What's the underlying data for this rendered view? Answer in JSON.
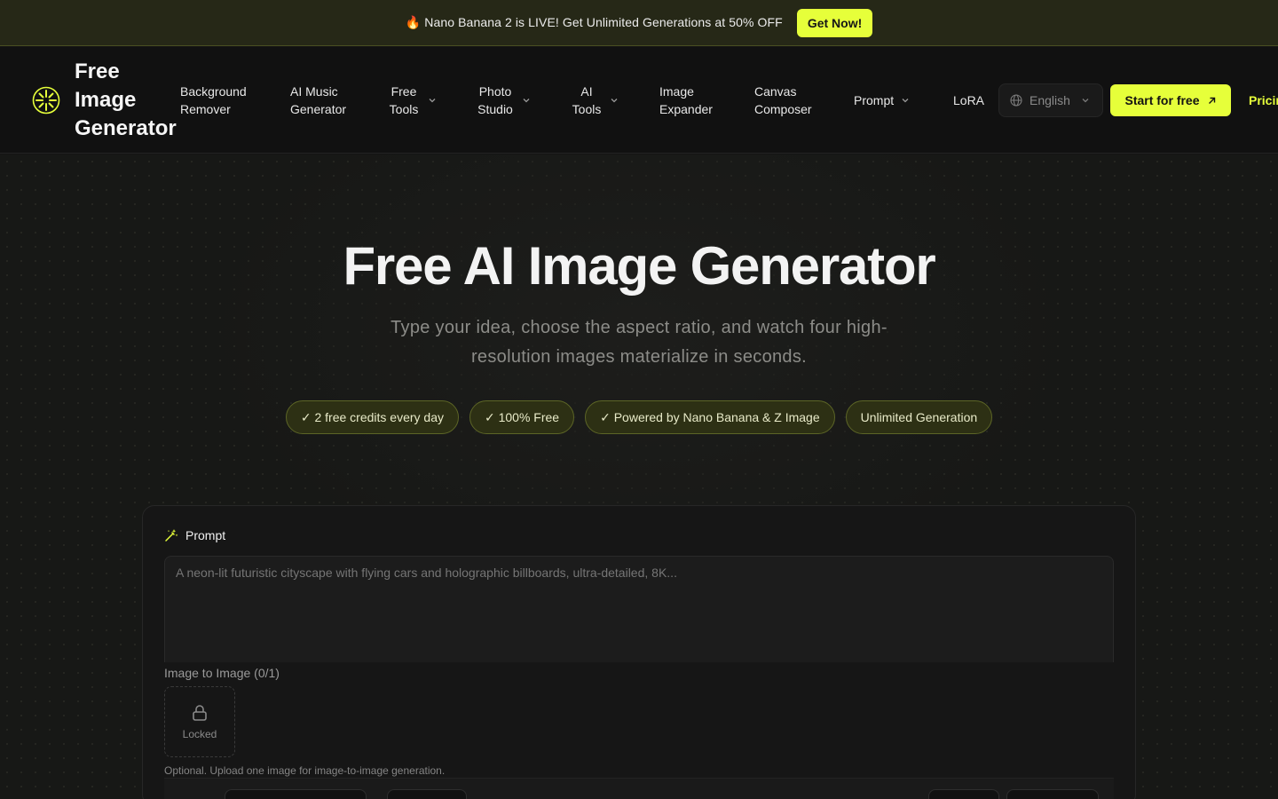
{
  "announcement": {
    "text": "🔥 Nano Banana 2 is LIVE! Get Unlimited Generations at 50% OFF",
    "button": "Get Now!"
  },
  "header": {
    "logo_text": "Free Image Generator",
    "nav": [
      {
        "label": "Background Remover",
        "dropdown": false
      },
      {
        "label": "AI Music Generator",
        "dropdown": false
      },
      {
        "label": "Free Tools",
        "dropdown": true
      },
      {
        "label": "Photo Studio",
        "dropdown": true
      },
      {
        "label": "AI Tools",
        "dropdown": true
      },
      {
        "label": "Image Expander",
        "dropdown": false
      },
      {
        "label": "Canvas Composer",
        "dropdown": false
      },
      {
        "label": "Prompt",
        "dropdown": true
      },
      {
        "label": "LoRA",
        "dropdown": false
      }
    ],
    "language": "English",
    "start_button": "Start for free",
    "pricing": "Pricing"
  },
  "hero": {
    "title": "Free AI Image Generator",
    "subtitle": "Type your idea, choose the aspect ratio, and watch four high-resolution images materialize in seconds.",
    "chips": [
      "✓ 2 free credits every day",
      "✓ 100% Free",
      "✓ Powered by Nano Banana & Z Image",
      "Unlimited Generation"
    ]
  },
  "generator": {
    "prompt_label": "Prompt",
    "prompt_placeholder": "A neon-lit futuristic cityscape with flying cars and holographic billboards, ultra-detailed, 8K...",
    "prompt_value": "",
    "i2i_label": "Image to Image (0/1)",
    "locked_label": "Locked",
    "help_text": "Optional. Upload one image for image-to-image generation."
  },
  "colors": {
    "accent": "#e6ff3a",
    "background": "#141414",
    "chip_bg": "#2d3014"
  }
}
